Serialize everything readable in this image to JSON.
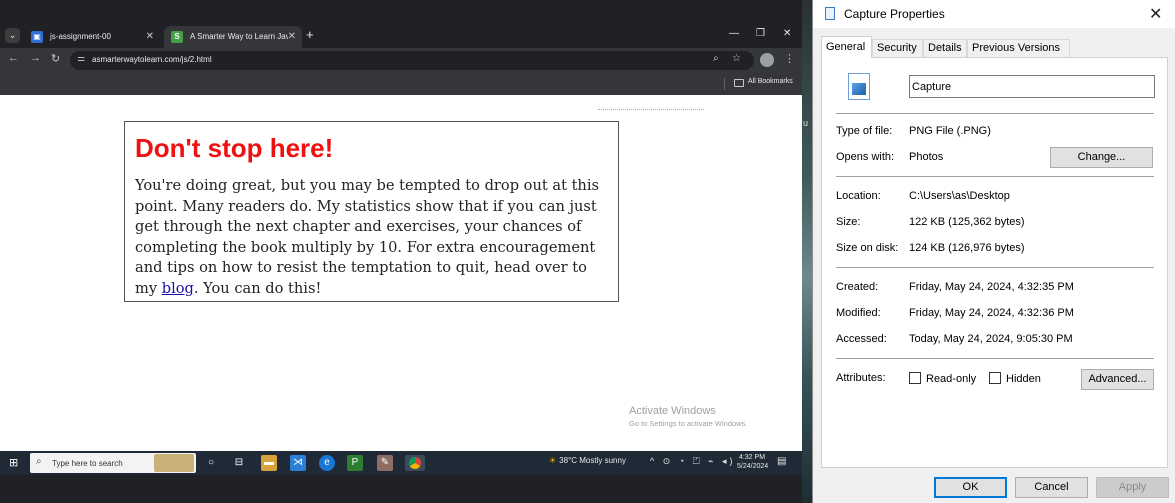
{
  "browser": {
    "tabs": [
      {
        "label": "js-assignment-00",
        "active": false
      },
      {
        "label": "A Smarter Way to Learn JavaScript",
        "active": true
      }
    ],
    "url": "asmarterwaytolearn.com/js/2.html",
    "bookmarks_label": "All Bookmarks",
    "page": {
      "heading": "Don't stop here!",
      "body_before_link": "You're doing great, but you may be tempted to drop out at this point. Many readers do. My statistics show that if you can just get through the next chapter and exercises, your chances of completing the book multiply by 10. For extra encouragement and tips on how to resist the temptation to quit, head over to my ",
      "link_text": "blog",
      "body_after_link": ". You can do this!"
    },
    "watermark": {
      "title": "Activate Windows",
      "subtitle": "Go to Settings to activate Windows."
    }
  },
  "taskbar": {
    "search_placeholder": "Type here to search",
    "weather": "38°C  Mostly sunny",
    "time": "4:32 PM",
    "date": "5/24/2024"
  },
  "desktop_edge_text": "u",
  "dialog": {
    "title": "Capture Properties",
    "tabs": [
      "General",
      "Security",
      "Details",
      "Previous Versions"
    ],
    "file_name": "Capture",
    "type_label": "Type of file:",
    "type_value": "PNG File (.PNG)",
    "opens_label": "Opens with:",
    "opens_value": "Photos",
    "change_button": "Change...",
    "location_label": "Location:",
    "location_value": "C:\\Users\\as\\Desktop",
    "size_label": "Size:",
    "size_value": "122 KB (125,362 bytes)",
    "size_disk_label": "Size on disk:",
    "size_disk_value": "124 KB (126,976 bytes)",
    "created_label": "Created:",
    "created_value": "Friday, May 24, 2024, 4:32:35 PM",
    "modified_label": "Modified:",
    "modified_value": "Friday, May 24, 2024, 4:32:36 PM",
    "accessed_label": "Accessed:",
    "accessed_value": "Today, May 24, 2024, 9:05:30 PM",
    "attributes_label": "Attributes:",
    "readonly_label": "Read-only",
    "hidden_label": "Hidden",
    "advanced_button": "Advanced...",
    "ok_button": "OK",
    "cancel_button": "Cancel",
    "apply_button": "Apply"
  },
  "colors": {
    "heading_red": "#ee1111",
    "link_blue": "#1a0dab",
    "ok_border": "#0078d7"
  }
}
